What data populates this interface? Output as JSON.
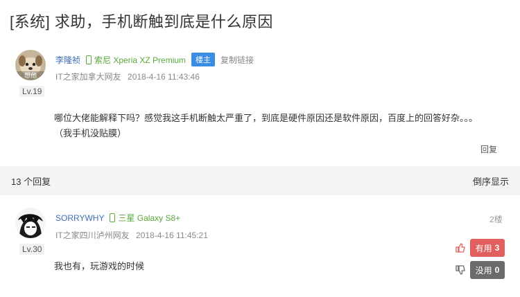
{
  "thread": {
    "title": "[系统] 求助，手机断触到底是什么原因"
  },
  "original_post": {
    "user": "李隆祯",
    "avatar_text": "想他",
    "device": "索尼 Xperia XZ Premium",
    "badge": "楼主",
    "copy_link": "复制链接",
    "location": "IT之家加拿大网友",
    "time": "2018-4-16 11:43:46",
    "level": "Lv.19",
    "content_line1": "哪位大佬能解释下吗？感觉我这手机断触太严重了，到底是硬件原因还是软件原因，百度上的回答好杂。。。",
    "content_line2": "（我手机没贴膜）",
    "reply_label": "回复"
  },
  "replies_bar": {
    "count_label": "13 个回复",
    "sort_label": "倒序显示"
  },
  "reply": {
    "user": "SORRYWHY",
    "device": "三星 Galaxy S8+",
    "location": "IT之家四川泸州网友",
    "time": "2018-4-16 11:45:21",
    "level": "Lv.30",
    "floor": "2楼",
    "content": "我也有，玩游戏的时候",
    "useful_label": "有用",
    "useful_count": "3",
    "useless_label": "没用",
    "useless_count": "0"
  },
  "colors": {
    "username": "#3b6fb6",
    "device": "#58a73b",
    "badge": "#3b8de3",
    "useful": "#e25f5f",
    "useless": "#6b6b6b"
  }
}
